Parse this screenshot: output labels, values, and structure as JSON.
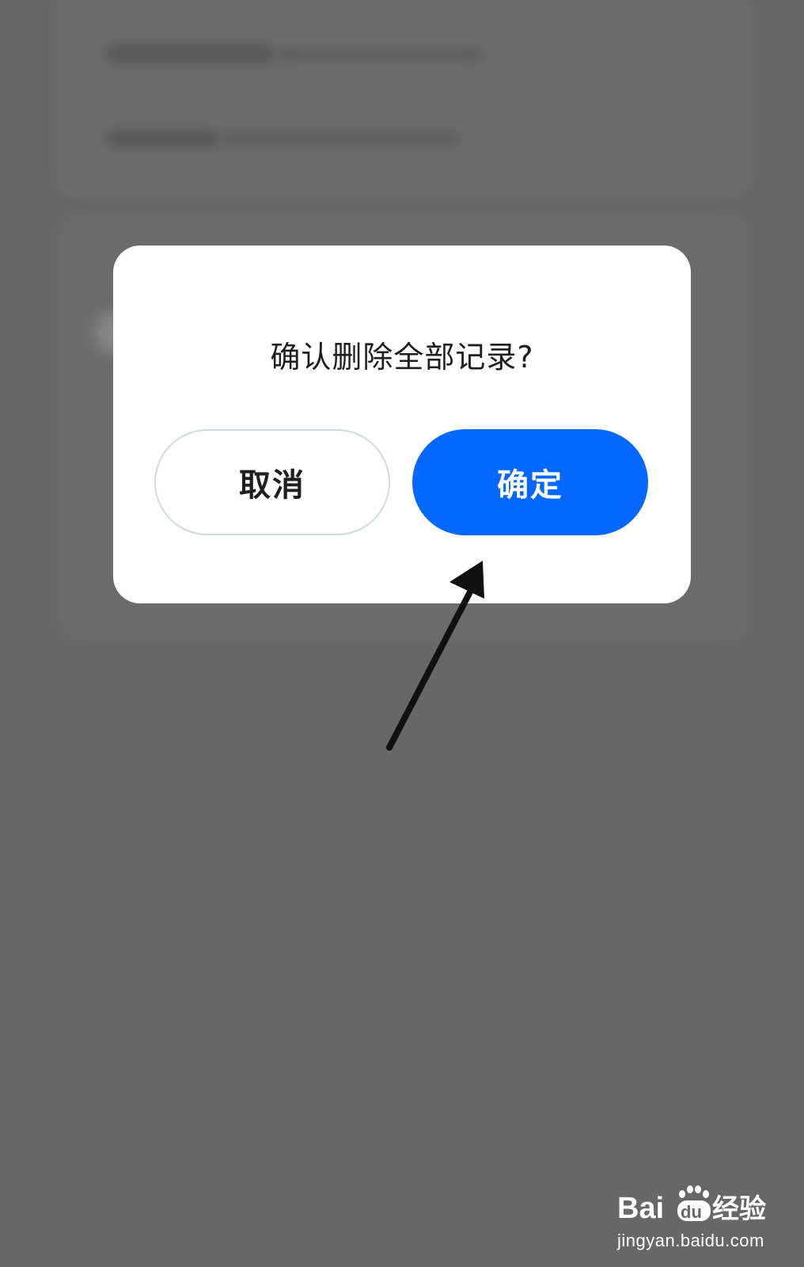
{
  "dialog": {
    "title": "确认删除全部记录?",
    "cancel_label": "取消",
    "confirm_label": "确定"
  },
  "colors": {
    "overlay": "#676767",
    "dialog_bg": "#ffffff",
    "confirm_bg": "#0468ff",
    "cancel_border": "#cfd9e6",
    "text": "#1f1f1f"
  },
  "annotation": {
    "icon": "arrow-pointer-icon"
  },
  "watermark": {
    "brand": "Baidu经验",
    "url": "jingyan.baidu.com"
  }
}
